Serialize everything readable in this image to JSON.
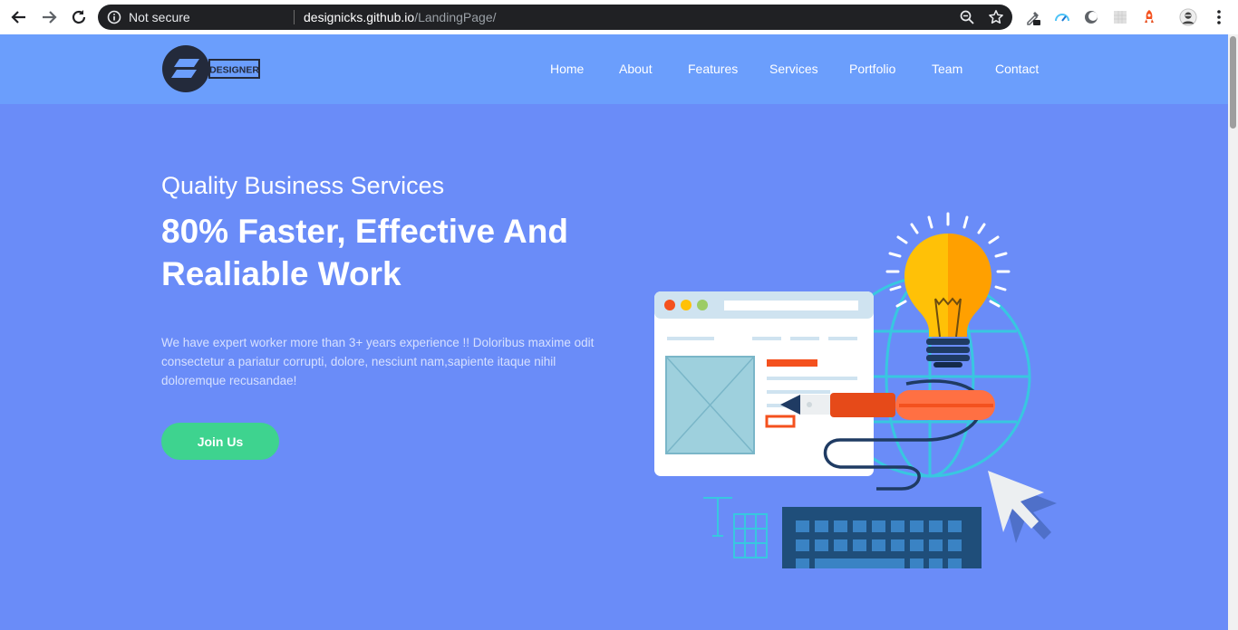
{
  "browser": {
    "security_label": "Not secure",
    "url_domain": "designicks.github.io",
    "url_path": "/LandingPage/",
    "icons": {
      "back": "arrow-left-icon",
      "forward": "arrow-right-icon",
      "reload": "reload-icon",
      "info": "info-icon",
      "zoom": "zoom-icon",
      "bookmark": "star-icon",
      "menu": "kebab-menu-icon"
    }
  },
  "site": {
    "logo_text": "DESIGNER",
    "nav": [
      {
        "label": "Home"
      },
      {
        "label": "About"
      },
      {
        "label": "Features"
      },
      {
        "label": "Services"
      },
      {
        "label": "Portfolio"
      },
      {
        "label": "Team"
      },
      {
        "label": "Contact"
      }
    ]
  },
  "hero": {
    "subtitle": "Quality Business Services",
    "title": "80% Faster, Effective And Realiable Work",
    "description": "We have expert worker more than 3+ years experience !! Doloribus maxime odit consectetur a pariatur corrupti, dolore, nesciunt nam,sapiente itaque nihil doloremque recusandae!",
    "cta_label": "Join Us"
  },
  "colors": {
    "page_bg": "#6a8cf8",
    "header_bg": "#6b9efc",
    "cta_bg": "#3ed38f",
    "omnibox_bg": "#202124"
  }
}
